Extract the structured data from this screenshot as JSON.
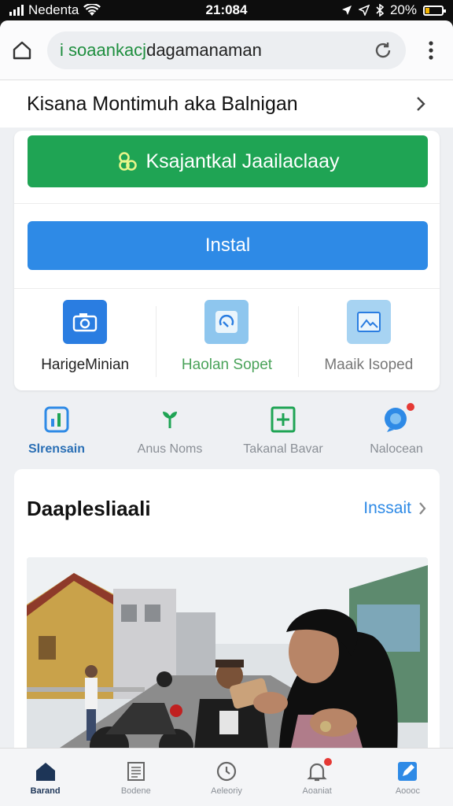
{
  "status_bar": {
    "carrier": "Nedenta",
    "time": "21:084",
    "battery": "20%"
  },
  "browser": {
    "url_scheme": "i soaankacj",
    "url_text": "dagamanaman"
  },
  "page_header": {
    "title": "Kisana Montimuh aka Balnigan"
  },
  "card": {
    "green_button_label": "Ksajantkal Jaailaclaay",
    "install_button_label": "Instal",
    "features": [
      {
        "label": "HarigeMinian",
        "color": "#222222",
        "icon": "camera-icon",
        "icon_bg": "#2a7de1"
      },
      {
        "label": "Haolan Sopet",
        "color": "#4aa35a",
        "icon": "headset-icon",
        "icon_bg": "#8ec6ee"
      },
      {
        "label": "Maaik Isoped",
        "color": "#777777",
        "icon": "image-folder-icon",
        "icon_bg": "#a7d3f2"
      }
    ]
  },
  "quick_links": [
    {
      "label": "Slrensain",
      "icon": "signal-card-icon",
      "active": true
    },
    {
      "label": "Anus Noms",
      "icon": "plant-icon",
      "active": false
    },
    {
      "label": "Takanal Bavar",
      "icon": "add-box-icon",
      "active": false
    },
    {
      "label": "Nalocean",
      "icon": "chat-bubble-icon",
      "active": false
    }
  ],
  "news": {
    "title": "Daaplesliaali",
    "more_label": "Inssait"
  },
  "bottom_nav": [
    {
      "label": "Barand",
      "icon": "home-icon",
      "active": true
    },
    {
      "label": "Bodene",
      "icon": "document-icon",
      "active": false
    },
    {
      "label": "Aeleoriy",
      "icon": "clock-icon",
      "active": false
    },
    {
      "label": "Aoaniat",
      "icon": "bell-icon",
      "active": false
    },
    {
      "label": "Aoooc",
      "icon": "edit-icon",
      "active": false
    }
  ],
  "colors": {
    "green": "#1fa454",
    "blue": "#2e8ae6",
    "link_blue": "#2a6fb5"
  }
}
